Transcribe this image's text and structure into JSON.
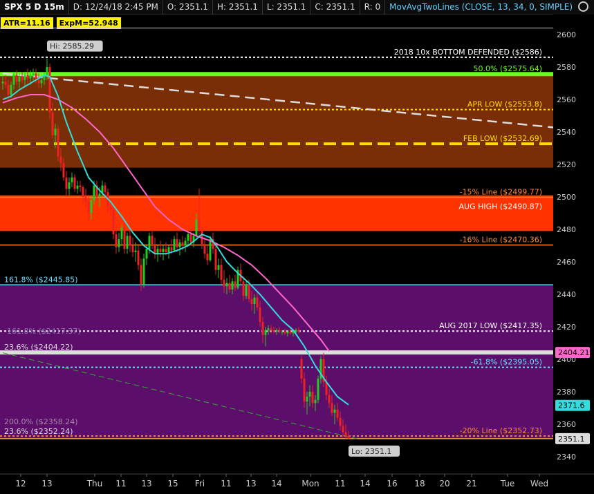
{
  "header": {
    "symbol": "SPX 5 D 15m",
    "date": "D: 12/24/18 2:45 PM",
    "open": "O: 2351.1",
    "high": "H: 2351.1",
    "low": "L: 2351.1",
    "close": "C: 2351.1",
    "range": "R: 0",
    "study": "MovAvgTwoLines (CLOSE, 13, 34, 0, SIMPLE)"
  },
  "badges": {
    "atr": "ATR=11.16",
    "expm": "ExpM=52.948"
  },
  "colors": {
    "background": "#000000",
    "zone_brown": "#7a2e08",
    "zone_red": "#ff3300",
    "zone_purple": "#5c0f6a",
    "bar_up": "#22cc22",
    "bar_down": "#ee2222",
    "ma_fast": "#33dddd",
    "ma_slow": "#ff66cc",
    "green_line": "#66ff22",
    "yellow_line": "#ffdd00"
  },
  "chart_data": {
    "type": "candlestick",
    "y_axis": {
      "min": 2330,
      "max": 2605,
      "ticks": [
        2340,
        2360,
        2380,
        2400,
        2420,
        2440,
        2460,
        2480,
        2500,
        2520,
        2540,
        2560,
        2580,
        2600
      ]
    },
    "x_axis": {
      "labels": [
        "12",
        "13",
        "Thu",
        "11",
        "13",
        "15",
        "Fri",
        "11",
        "13",
        "14",
        "Mon",
        "11",
        "14",
        "16",
        "18",
        "20",
        "21",
        "Tue",
        "Wed"
      ]
    },
    "zones": [
      {
        "from": 2518,
        "to": 2575,
        "color": "#7a2e08"
      },
      {
        "from": 2479,
        "to": 2501,
        "color": "#ff3300"
      },
      {
        "from": 2351,
        "to": 2446,
        "color": "#5c0f6a"
      }
    ],
    "levels": [
      {
        "price": 2586,
        "label": "2018   10x BOTTOM DEFENDED   ($2586)",
        "color": "#ffffff",
        "style": "dotted",
        "align": "right"
      },
      {
        "price": 2575.64,
        "label": "50.0% ($2575.64)",
        "color": "#66ff22",
        "style": "solid-thick",
        "align": "right"
      },
      {
        "price": 2553.8,
        "label": "APR  LOW   ($2553.8)",
        "color": "#ffdd00",
        "style": "dotted",
        "align": "right"
      },
      {
        "price": 2532.69,
        "label": "FEB  LOW   ($2532.69)",
        "color": "#ffdd00",
        "style": "dashed-thick",
        "align": "right"
      },
      {
        "price": 2499.77,
        "label": "-15% Line   ($2499.77)",
        "color": "#ff8833",
        "style": "solid",
        "align": "right"
      },
      {
        "price": 2490.87,
        "label": "AUG HIGH  ($2490.87)",
        "color": "#ffffff",
        "style": "none",
        "align": "right"
      },
      {
        "price": 2470.36,
        "label": "-16% Line   ($2470.36)",
        "color": "#ff8833",
        "style": "solid",
        "align": "right"
      },
      {
        "price": 2445.85,
        "label": "161.8%  ($2445.85)",
        "color": "#66ddff",
        "style": "solid",
        "align": "left"
      },
      {
        "price": 2417.35,
        "label": "AUG 2017 LOW ($2417.35)",
        "color": "#ffffff",
        "style": "dotted",
        "align": "right"
      },
      {
        "price": 2404.22,
        "label": "23.6%  ($2404.22)",
        "color": "#dddddd",
        "style": "solid-thick",
        "align": "left"
      },
      {
        "price": 2395.05,
        "label": "-61.8%  ($2395.05)",
        "color": "#66ddff",
        "style": "dotted",
        "align": "right"
      },
      {
        "price": 2358.24,
        "label": "200.0%  ($2358.24)",
        "color": "#aa88aa",
        "style": "none",
        "align": "left"
      },
      {
        "price": 2352.73,
        "label": "-20% Line   ($2352.73)",
        "color": "#ff8833",
        "style": "dotted",
        "align": "right"
      },
      {
        "price": 2352.24,
        "label": "23.6%  ($2352.24)",
        "color": "#dddddd",
        "style": "none",
        "align": "left"
      },
      {
        "price": 2351.1,
        "label": "",
        "color": "#ffaa33",
        "style": "solid",
        "align": "right"
      }
    ],
    "faint_label": {
      "price": 2417.35,
      "text": "161.8%  ($2417.37)"
    },
    "price_tags": [
      {
        "price": 2404.21,
        "text": "2404.21",
        "bg": "#ff66cc",
        "fg": "#000000"
      },
      {
        "price": 2371.6,
        "text": "2371.6",
        "bg": "#33dddd",
        "fg": "#000000"
      },
      {
        "price": 2351.1,
        "text": "2351.1",
        "bg": "#dddddd",
        "fg": "#000000"
      }
    ],
    "annotations": [
      {
        "text": "Hi: 2585.29",
        "bar": 16,
        "price": 2585.29,
        "position": "above"
      },
      {
        "text": "Lo: 2351.1",
        "bar": 126,
        "price": 2351.1,
        "position": "below"
      }
    ],
    "trendlines": [
      {
        "from": {
          "bar": 0,
          "price": 2576
        },
        "to": {
          "bar": 210,
          "price": 2541
        },
        "color": "#dddddd",
        "style": "dashed"
      },
      {
        "from": {
          "bar": 0,
          "price": 2404
        },
        "to": {
          "bar": 128,
          "price": 2351
        },
        "color": "#33aa33",
        "style": "dashed"
      }
    ],
    "ohlc": [
      [
        2570,
        2574,
        2566,
        2571
      ],
      [
        2571,
        2575,
        2567,
        2569
      ],
      [
        2569,
        2572,
        2560,
        2563
      ],
      [
        2563,
        2571,
        2561,
        2569
      ],
      [
        2569,
        2577,
        2566,
        2575
      ],
      [
        2575,
        2578,
        2569,
        2571
      ],
      [
        2571,
        2576,
        2567,
        2574
      ],
      [
        2574,
        2577,
        2570,
        2572
      ],
      [
        2572,
        2577,
        2568,
        2575
      ],
      [
        2575,
        2579,
        2570,
        2573
      ],
      [
        2573,
        2578,
        2569,
        2575
      ],
      [
        2575,
        2579,
        2571,
        2576
      ],
      [
        2576,
        2579,
        2570,
        2572
      ],
      [
        2572,
        2576,
        2567,
        2570
      ],
      [
        2570,
        2574,
        2567,
        2572
      ],
      [
        2572,
        2577,
        2569,
        2575
      ],
      [
        2575,
        2585.29,
        2572,
        2580
      ],
      [
        2580,
        2582,
        2548,
        2552
      ],
      [
        2552,
        2558,
        2536,
        2538
      ],
      [
        2538,
        2545,
        2530,
        2542
      ],
      [
        2542,
        2544,
        2522,
        2525
      ],
      [
        2525,
        2530,
        2516,
        2521
      ],
      [
        2521,
        2524,
        2510,
        2512
      ],
      [
        2512,
        2516,
        2500,
        2505
      ],
      [
        2505,
        2512,
        2501,
        2509
      ],
      [
        2509,
        2515,
        2506,
        2512
      ],
      [
        2512,
        2514,
        2503,
        2505
      ],
      [
        2505,
        2510,
        2502,
        2507
      ],
      [
        2507,
        2510,
        2503,
        2506
      ],
      [
        2506,
        2507,
        2496,
        2500
      ],
      [
        2500,
        2505,
        2493,
        2497
      ],
      [
        2497,
        2500,
        2484,
        2490
      ],
      [
        2490,
        2501,
        2486,
        2498
      ],
      [
        2498,
        2510,
        2495,
        2507
      ],
      [
        2507,
        2510,
        2498,
        2500
      ],
      [
        2500,
        2506,
        2494,
        2502
      ],
      [
        2502,
        2510,
        2500,
        2507
      ],
      [
        2507,
        2509,
        2500,
        2503
      ],
      [
        2503,
        2505,
        2490,
        2494
      ],
      [
        2494,
        2498,
        2488,
        2492
      ],
      [
        2492,
        2495,
        2474,
        2477
      ],
      [
        2477,
        2483,
        2465,
        2469
      ],
      [
        2469,
        2478,
        2466,
        2474
      ],
      [
        2474,
        2483,
        2470,
        2481
      ],
      [
        2481,
        2484,
        2465,
        2468
      ],
      [
        2468,
        2478,
        2465,
        2476
      ],
      [
        2476,
        2480,
        2466,
        2470
      ],
      [
        2470,
        2475,
        2463,
        2466
      ],
      [
        2466,
        2472,
        2460,
        2467
      ],
      [
        2467,
        2470,
        2455,
        2458
      ],
      [
        2458,
        2462,
        2442,
        2446
      ],
      [
        2446,
        2465,
        2444,
        2462
      ],
      [
        2462,
        2470,
        2458,
        2468
      ],
      [
        2468,
        2478,
        2465,
        2476
      ],
      [
        2476,
        2480,
        2468,
        2471
      ],
      [
        2471,
        2475,
        2462,
        2465
      ],
      [
        2465,
        2470,
        2460,
        2468
      ],
      [
        2468,
        2473,
        2463,
        2466
      ],
      [
        2466,
        2470,
        2461,
        2468
      ],
      [
        2468,
        2472,
        2464,
        2466
      ],
      [
        2466,
        2470,
        2462,
        2469
      ],
      [
        2469,
        2474,
        2465,
        2467
      ],
      [
        2467,
        2476,
        2466,
        2474
      ],
      [
        2474,
        2478,
        2466,
        2469
      ],
      [
        2469,
        2474,
        2464,
        2472
      ],
      [
        2472,
        2476,
        2467,
        2470
      ],
      [
        2470,
        2475,
        2466,
        2473
      ],
      [
        2473,
        2479,
        2470,
        2477
      ],
      [
        2477,
        2480,
        2470,
        2472
      ],
      [
        2472,
        2478,
        2469,
        2476
      ],
      [
        2476,
        2490,
        2475,
        2486
      ],
      [
        2486,
        2505,
        2476,
        2479
      ],
      [
        2479,
        2482,
        2468,
        2471
      ],
      [
        2471,
        2475,
        2462,
        2465
      ],
      [
        2465,
        2470,
        2458,
        2461
      ],
      [
        2461,
        2476,
        2460,
        2474
      ],
      [
        2474,
        2478,
        2465,
        2468
      ],
      [
        2468,
        2472,
        2452,
        2455
      ],
      [
        2455,
        2462,
        2450,
        2458
      ],
      [
        2458,
        2462,
        2446,
        2449
      ],
      [
        2449,
        2455,
        2441,
        2445
      ],
      [
        2445,
        2450,
        2440,
        2447
      ],
      [
        2447,
        2452,
        2441,
        2443
      ],
      [
        2443,
        2450,
        2440,
        2448
      ],
      [
        2448,
        2452,
        2442,
        2444
      ],
      [
        2444,
        2457,
        2443,
        2455
      ],
      [
        2455,
        2459,
        2446,
        2448
      ],
      [
        2448,
        2451,
        2436,
        2439
      ],
      [
        2439,
        2448,
        2437,
        2446
      ],
      [
        2446,
        2449,
        2435,
        2437
      ],
      [
        2437,
        2442,
        2430,
        2434
      ],
      [
        2434,
        2440,
        2428,
        2438
      ],
      [
        2438,
        2442,
        2430,
        2432
      ],
      [
        2432,
        2436,
        2420,
        2423
      ],
      [
        2423,
        2426,
        2410,
        2415
      ],
      [
        2415,
        2420,
        2408,
        2418
      ],
      [
        2418,
        2421,
        2415,
        2419
      ],
      [
        2419,
        2421,
        2416,
        2418
      ],
      [
        2418,
        2420,
        2416,
        2417
      ],
      [
        2417,
        2419,
        2415,
        2418
      ],
      [
        2418,
        2420,
        2416,
        2417
      ],
      [
        2417,
        2418,
        2415,
        2417
      ],
      [
        2417,
        2419,
        2415,
        2416
      ],
      [
        2416,
        2418,
        2414,
        2417
      ],
      [
        2417,
        2419,
        2415,
        2416
      ],
      [
        2416,
        2418,
        2414,
        2417
      ],
      [
        2417,
        2419,
        2415,
        2418
      ],
      [
        2418,
        2420,
        2416,
        2417
      ],
      [
        2400,
        2402,
        2385,
        2388
      ],
      [
        2388,
        2392,
        2370,
        2374
      ],
      [
        2374,
        2380,
        2366,
        2377
      ],
      [
        2377,
        2384,
        2371,
        2380
      ],
      [
        2380,
        2384,
        2370,
        2373
      ],
      [
        2373,
        2378,
        2368,
        2375
      ],
      [
        2375,
        2390,
        2373,
        2388
      ],
      [
        2388,
        2402,
        2385,
        2400
      ],
      [
        2400,
        2404,
        2383,
        2386
      ],
      [
        2386,
        2390,
        2375,
        2378
      ],
      [
        2378,
        2382,
        2370,
        2373
      ],
      [
        2373,
        2378,
        2365,
        2367
      ],
      [
        2367,
        2372,
        2360,
        2369
      ],
      [
        2369,
        2373,
        2362,
        2364
      ],
      [
        2364,
        2368,
        2356,
        2359
      ],
      [
        2359,
        2363,
        2352,
        2355
      ],
      [
        2355,
        2360,
        2351.1,
        2353
      ],
      [
        2353,
        2356,
        2351.1,
        2351.1
      ]
    ],
    "ma_fast": [
      [
        0,
        2560
      ],
      [
        3,
        2562
      ],
      [
        6,
        2566
      ],
      [
        9,
        2569
      ],
      [
        12,
        2572
      ],
      [
        15,
        2575
      ],
      [
        17,
        2574
      ],
      [
        20,
        2562
      ],
      [
        23,
        2546
      ],
      [
        27,
        2528
      ],
      [
        31,
        2512
      ],
      [
        35,
        2504
      ],
      [
        39,
        2497
      ],
      [
        43,
        2488
      ],
      [
        47,
        2478
      ],
      [
        51,
        2470
      ],
      [
        55,
        2465
      ],
      [
        59,
        2465
      ],
      [
        63,
        2467
      ],
      [
        67,
        2470
      ],
      [
        70,
        2474
      ],
      [
        72,
        2477
      ],
      [
        75,
        2475
      ],
      [
        78,
        2468
      ],
      [
        81,
        2460
      ],
      [
        85,
        2453
      ],
      [
        89,
        2447
      ],
      [
        93,
        2440
      ],
      [
        97,
        2432
      ],
      [
        101,
        2424
      ],
      [
        105,
        2418
      ],
      [
        109,
        2408
      ],
      [
        113,
        2396
      ],
      [
        117,
        2386
      ],
      [
        121,
        2377
      ],
      [
        125,
        2372
      ]
    ],
    "ma_slow": [
      [
        0,
        2558
      ],
      [
        5,
        2561
      ],
      [
        10,
        2563
      ],
      [
        15,
        2563
      ],
      [
        20,
        2560
      ],
      [
        25,
        2555
      ],
      [
        30,
        2548
      ],
      [
        35,
        2540
      ],
      [
        40,
        2530
      ],
      [
        45,
        2518
      ],
      [
        50,
        2506
      ],
      [
        55,
        2494
      ],
      [
        60,
        2486
      ],
      [
        65,
        2480
      ],
      [
        70,
        2476
      ],
      [
        75,
        2473
      ],
      [
        80,
        2469
      ],
      [
        85,
        2464
      ],
      [
        90,
        2458
      ],
      [
        95,
        2450
      ],
      [
        100,
        2441
      ],
      [
        105,
        2432
      ],
      [
        110,
        2422
      ],
      [
        115,
        2412
      ],
      [
        118,
        2405
      ]
    ]
  }
}
